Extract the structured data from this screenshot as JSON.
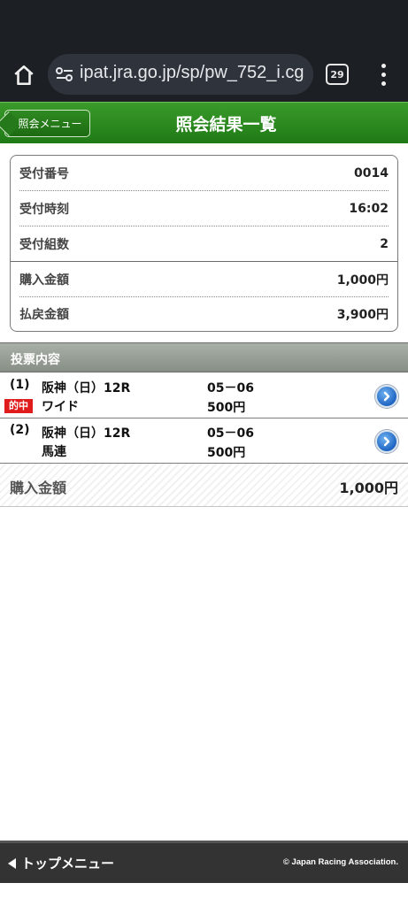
{
  "browser": {
    "url": "ipat.jra.go.jp/sp/pw_752_i.cg",
    "tab_count": "29"
  },
  "header": {
    "back_label": "照会メニュー",
    "title": "照会結果一覧"
  },
  "summary": {
    "rows": [
      {
        "label": "受付番号",
        "value": "0014"
      },
      {
        "label": "受付時刻",
        "value": "16:02"
      },
      {
        "label": "受付組数",
        "value": "2"
      },
      {
        "label": "購入金額",
        "value": "1,000円"
      },
      {
        "label": "払戻金額",
        "value": "3,900円"
      }
    ]
  },
  "votes": {
    "section_title": "投票内容",
    "items": [
      {
        "no": "(1)",
        "race": "阪神（日）12R",
        "bet_type": "ワイド",
        "combo": "05－06",
        "amount": "500円",
        "hit_label": "的中"
      },
      {
        "no": "(2)",
        "race": "阪神（日）12R",
        "bet_type": "馬連",
        "combo": "05－06",
        "amount": "500円"
      }
    ]
  },
  "total": {
    "label": "購入金額",
    "value": "1,000円"
  },
  "footer": {
    "top_menu": "トップメニュー",
    "copyright": "© Japan Racing Association."
  },
  "colors": {
    "header_green": "#2a8a1f",
    "hit_red": "#e01b1b",
    "arrow_blue": "#1f64c2"
  }
}
